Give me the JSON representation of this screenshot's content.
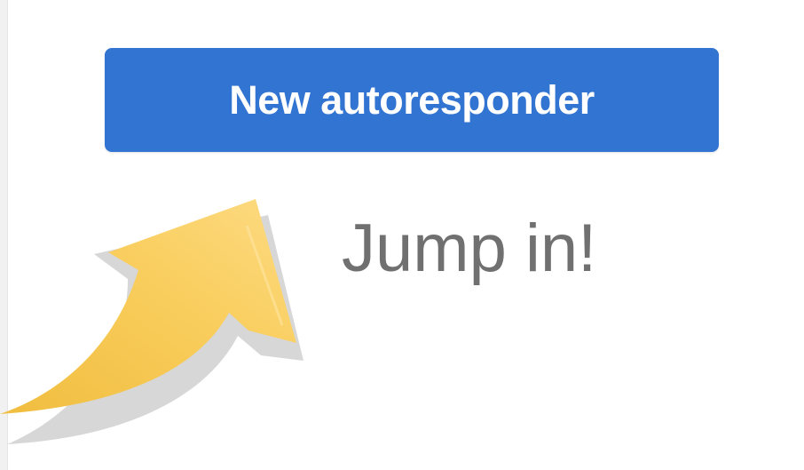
{
  "new_autoresponder_button": {
    "label": "New autoresponder",
    "color": "#3274d1"
  },
  "hint": {
    "text": "Jump in!",
    "color": "#707070"
  },
  "arrow": {
    "icon": "curved-up-arrow-icon",
    "fill_color": "#f9cd5c",
    "shadow_color": "#d3d3d3"
  }
}
